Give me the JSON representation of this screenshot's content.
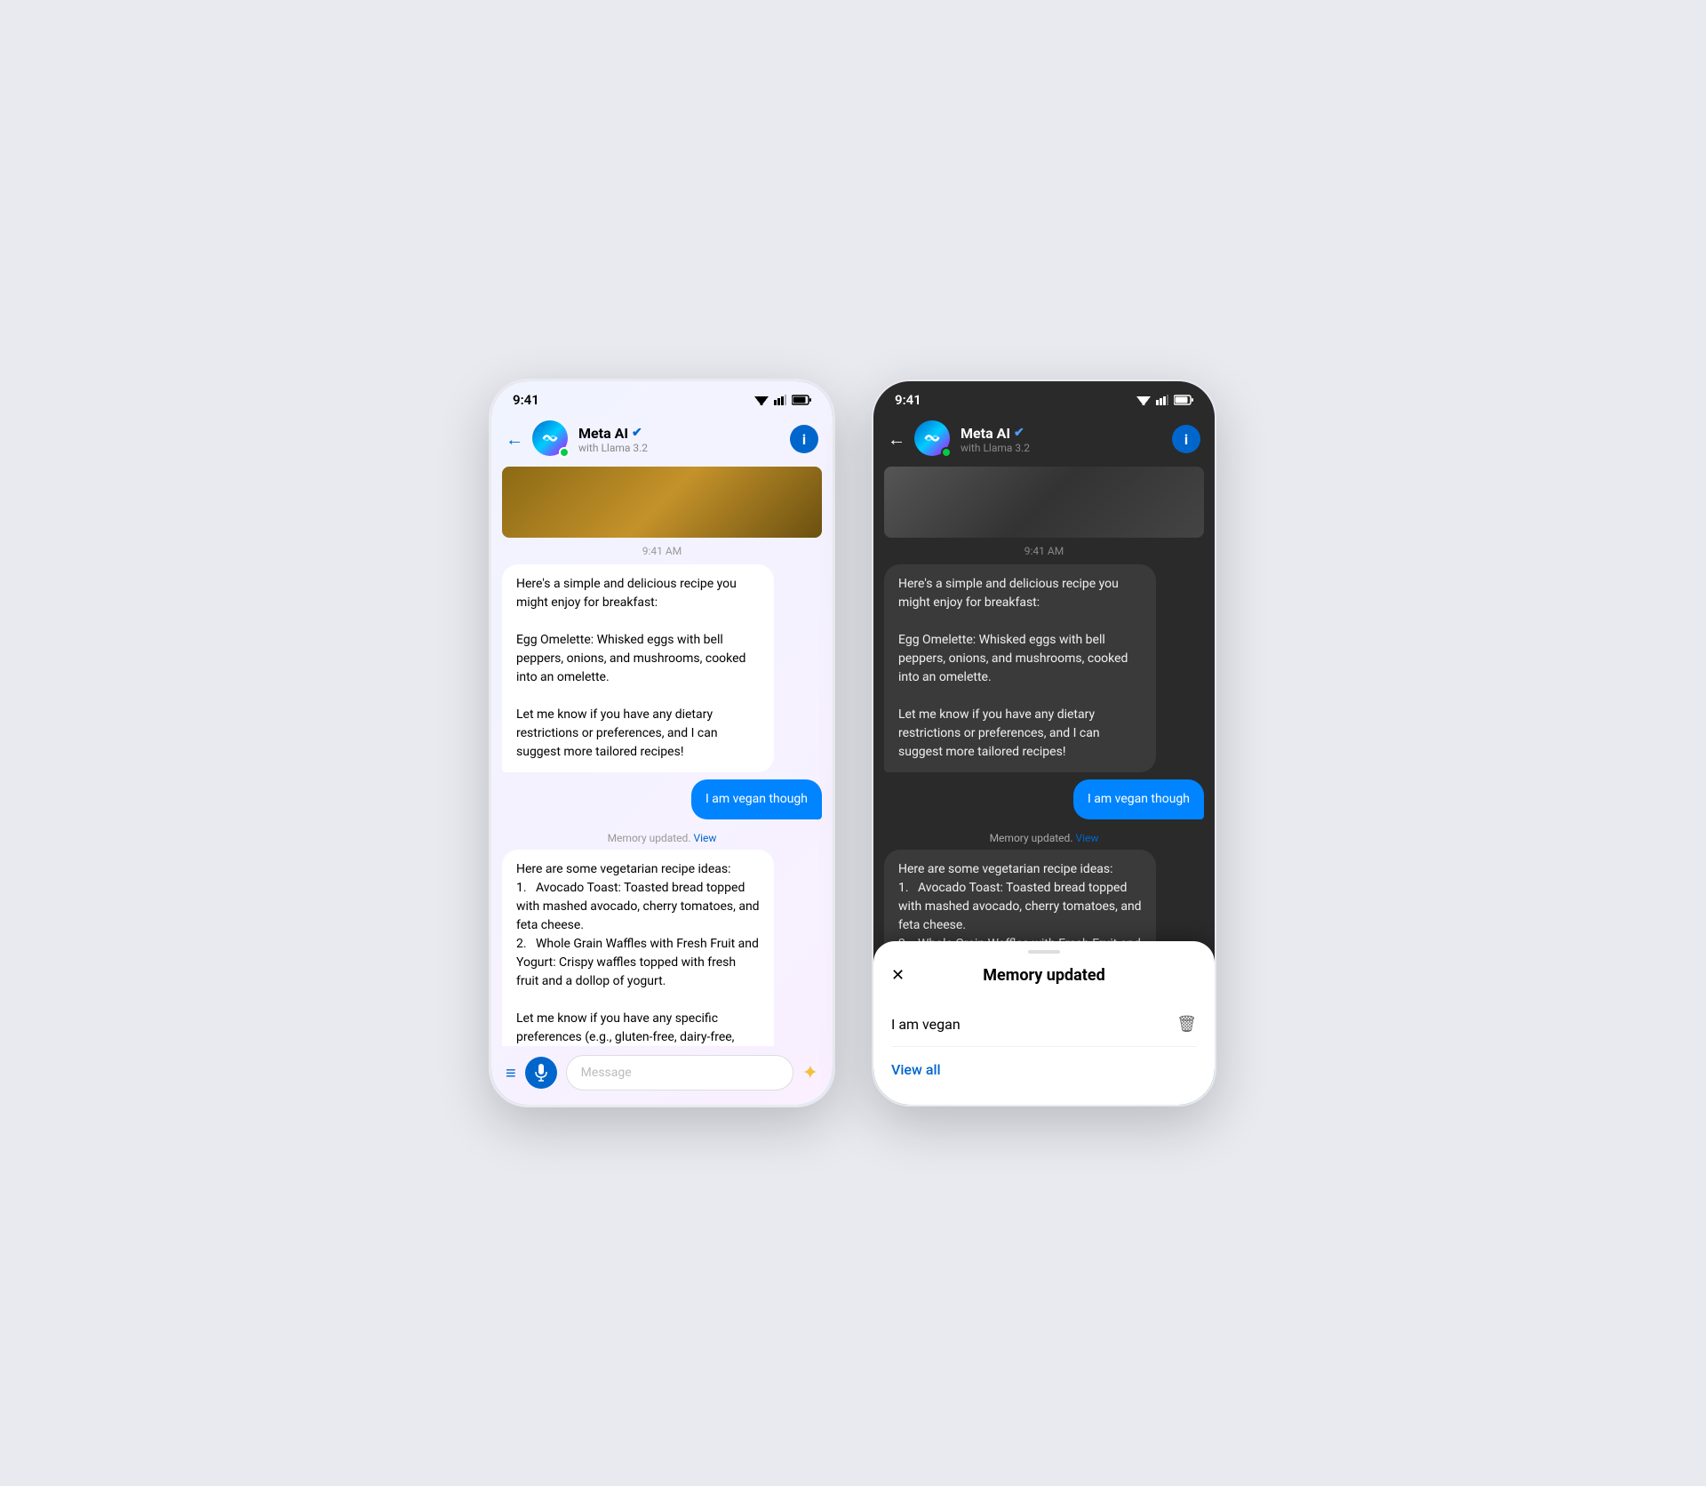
{
  "page": {
    "background": "#e8eaf0"
  },
  "phone_left": {
    "status_bar": {
      "time": "9:41"
    },
    "header": {
      "name": "Meta AI",
      "verified": "✓",
      "subtitle": "with Llama 3.2",
      "info_label": "i",
      "back_label": "←"
    },
    "chat": {
      "time_label": "9:41 AM",
      "ai_message_1": "Here's a simple and delicious recipe you might enjoy for breakfast:\n\nEgg Omelette: Whisked eggs with bell peppers, onions, and mushrooms, cooked into an omelette.\n\nLet me know if you have any dietary restrictions or preferences, and I can suggest more tailored recipes!",
      "user_message": "I am vegan though",
      "memory_note": "Memory updated.",
      "memory_view": "View",
      "ai_message_2": "Here are some vegetarian recipe ideas:\n1.  Avocado Toast: Toasted bread topped with mashed avocado, cherry tomatoes, and feta cheese.\n2.  Whole Grain Waffles with Fresh Fruit and Yogurt: Crispy waffles topped with fresh fruit and a dollop of yogurt.\n\nLet me know if you have any specific preferences (e.g., gluten-free, dairy-free, etc.) or if you'd like more ideas!"
    },
    "input_bar": {
      "placeholder": "Message",
      "hamburger_symbol": "≡",
      "sparkle_symbol": "✦"
    }
  },
  "phone_right": {
    "status_bar": {
      "time": "9:41"
    },
    "header": {
      "name": "Meta AI",
      "verified": "✓",
      "subtitle": "with Llama 3.2",
      "info_label": "i",
      "back_label": "←"
    },
    "chat": {
      "time_label": "9:41 AM",
      "ai_message_1": "Here's a simple and delicious recipe you might enjoy for breakfast:\n\nEgg Omelette: Whisked eggs with bell peppers, onions, and mushrooms, cooked into an omelette.\n\nLet me know if you have any dietary restrictions or preferences, and I can suggest more tailored recipes!",
      "user_message": "I am vegan though",
      "memory_note": "Memory updated.",
      "memory_view": "View",
      "ai_message_2_partial": "Here are some vegetarian recipe ideas:\n1.  Avocado Toast: Toasted bread topped with mashed avocado, cherry tomatoes, and feta cheese.\n2.  Whole Grain Waffles with Fresh Fruit and Yogurt: Crispy waffles topped with"
    },
    "modal": {
      "title": "Memory updated",
      "close_label": "✕",
      "memory_item": "I am vegan",
      "trash_label": "🗑",
      "view_all": "View all"
    }
  }
}
